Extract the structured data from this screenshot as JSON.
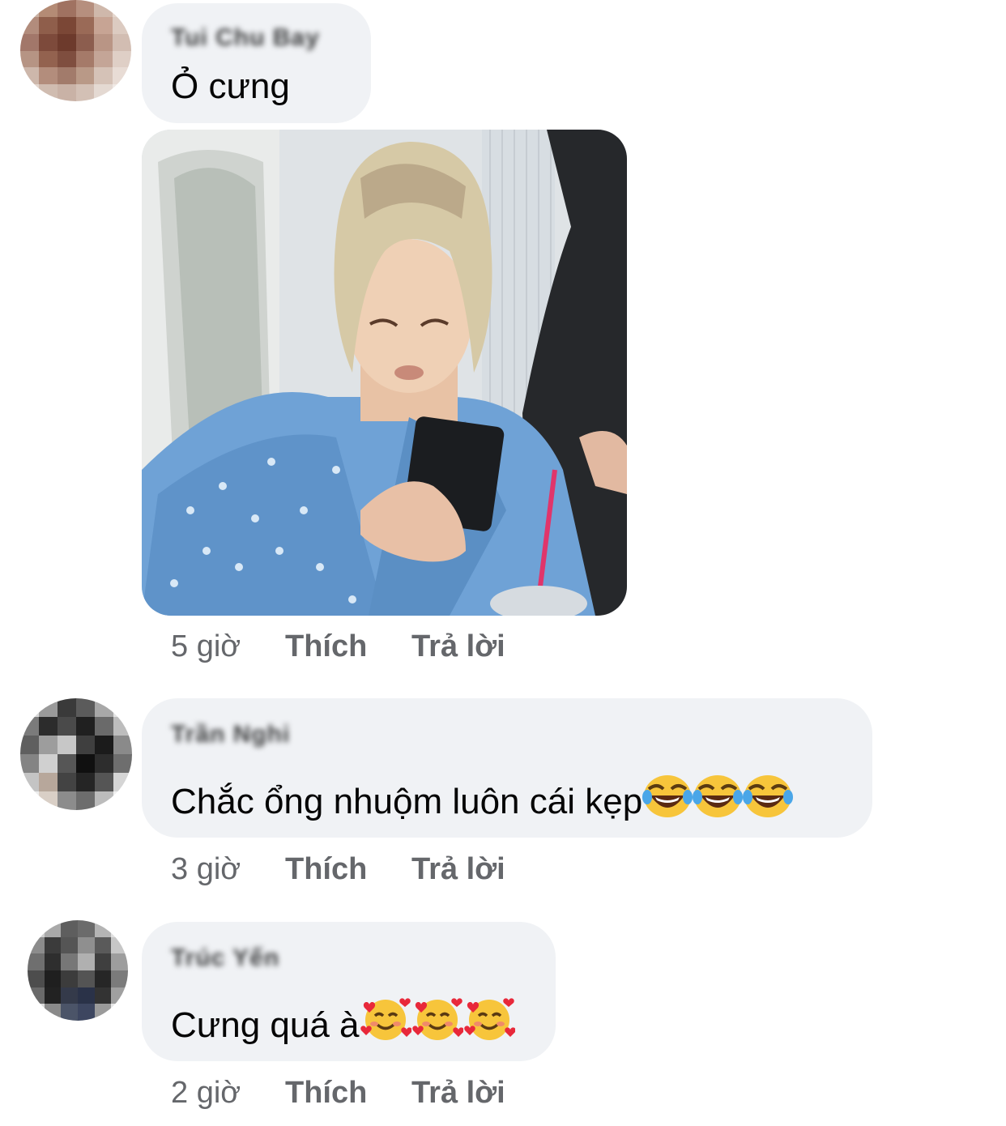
{
  "comments": [
    {
      "author": "Tui Chu Bay",
      "text": "Ỏ cưng",
      "time": "5 giờ",
      "like": "Thích",
      "reply": "Trả lời",
      "has_photo": true
    },
    {
      "author": "Trần Nghi",
      "text": "Chắc ổng nhuộm luôn cái kẹp",
      "emoji": [
        "joy-icon",
        "joy-icon",
        "joy-icon"
      ],
      "time": "3 giờ",
      "like": "Thích",
      "reply": "Trả lời"
    },
    {
      "author": "Trúc Yến",
      "text": "Cưng quá à",
      "emoji": [
        "smiling-hearts-icon",
        "smiling-hearts-icon",
        "smiling-hearts-icon"
      ],
      "time": "2 giờ",
      "like": "Thích",
      "reply": "Trả lời"
    }
  ],
  "colors": {
    "bubble": "#f0f2f5",
    "meta_text": "#65676b",
    "body_text": "#050505"
  }
}
